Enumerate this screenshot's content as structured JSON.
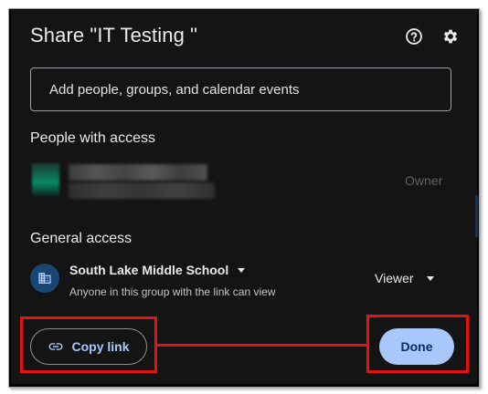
{
  "dialog": {
    "title": "Share \"IT Testing \"",
    "help_icon": "help-circle-icon",
    "settings_icon": "gear-icon"
  },
  "add_people": {
    "placeholder": "Add people, groups, and calendar events"
  },
  "people_with_access": {
    "heading": "People with access",
    "people": [
      {
        "name": "",
        "email": "",
        "role": "Owner",
        "avatar": "blurred-avatar"
      }
    ]
  },
  "general_access": {
    "heading": "General access",
    "group_icon": "building-icon",
    "group_name": "South Lake Middle School",
    "description": "Anyone in this group with the link can view",
    "role": "Viewer"
  },
  "footer": {
    "copy_link_label": "Copy link",
    "copy_link_icon": "link-icon",
    "done_label": "Done"
  },
  "annotation": {
    "highlight_color": "#e41212"
  },
  "colors": {
    "background": "#141414",
    "text": "#e8eaed",
    "accent": "#a8c7fa",
    "group_avatar": "#1a4673"
  }
}
